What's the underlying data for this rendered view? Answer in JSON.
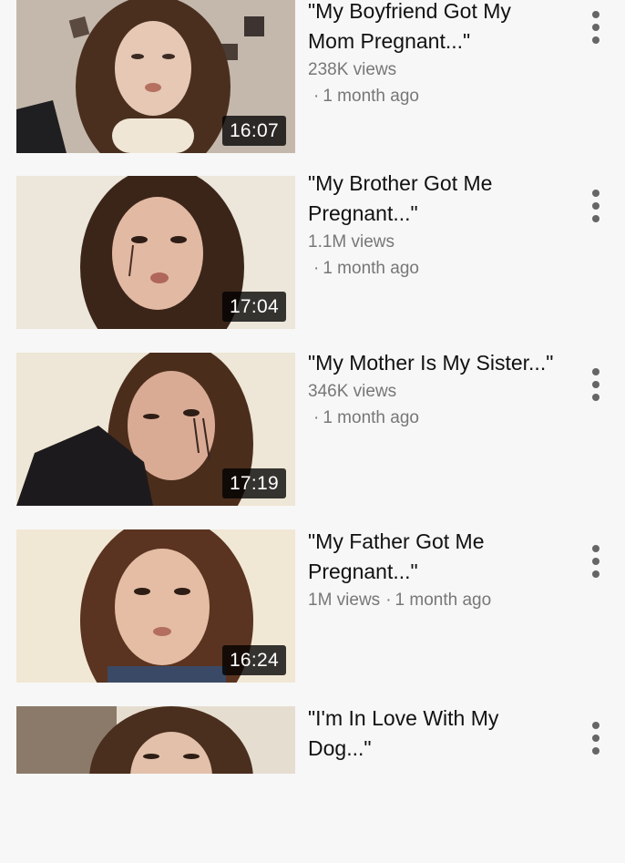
{
  "videos": [
    {
      "title": "\"My Boyfriend Got My Mom Pregnant...\"",
      "views": "238K views",
      "age": "1 month ago",
      "duration": "16:07",
      "thumb_bg": "#c9bfb6",
      "skin": "#e6c8b4",
      "hair": "#4a2f1f"
    },
    {
      "title": "\"My Brother Got Me Pregnant...\"",
      "views": "1.1M views",
      "age": "1 month ago",
      "duration": "17:04",
      "thumb_bg": "#ece6db",
      "skin": "#e2b9a3",
      "hair": "#3b2519"
    },
    {
      "title": "\"My Mother Is My Sister...\"",
      "views": "346K views",
      "age": "1 month ago",
      "duration": "17:19",
      "thumb_bg": "#eee6d6",
      "skin": "#d9ab95",
      "hair": "#4b2d1c"
    },
    {
      "title": "\"My Father Got Me Pregnant...\"",
      "views": "1M views",
      "age": "1 month ago",
      "duration": "16:24",
      "thumb_bg": "#f1e7d5",
      "skin": "#e4bda4",
      "hair": "#5a3420"
    },
    {
      "title": "\"I'm In Love With My Dog...\"",
      "views": "",
      "age": "",
      "duration": "",
      "thumb_bg": "#e6ddd1",
      "skin": "#e2c0a9",
      "hair": "#4a2e1e"
    }
  ]
}
